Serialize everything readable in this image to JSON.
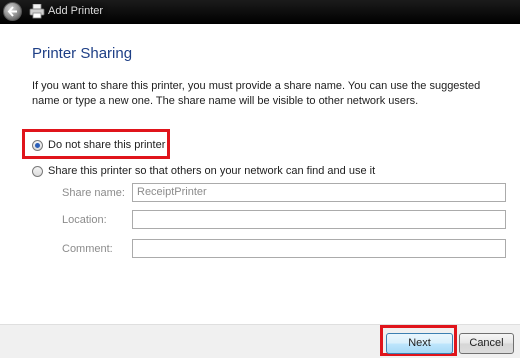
{
  "window": {
    "title": "Add Printer"
  },
  "page": {
    "title": "Printer Sharing",
    "description": "If you want to share this printer, you must provide a share name. You can use the suggested name or type a new one. The share name will be visible to other network users."
  },
  "options": {
    "do_not_share": {
      "label": "Do not share this printer",
      "selected": true
    },
    "share": {
      "label": "Share this printer so that others on your network can find and use it",
      "selected": false
    }
  },
  "fields": {
    "share_name": {
      "label": "Share name:",
      "value": "ReceiptPrinter"
    },
    "location": {
      "label": "Location:",
      "value": ""
    },
    "comment": {
      "label": "Comment:",
      "value": ""
    }
  },
  "buttons": {
    "next": "Next",
    "cancel": "Cancel"
  },
  "colors": {
    "highlight": "#e0141b",
    "title_blue": "#1e3f86"
  }
}
